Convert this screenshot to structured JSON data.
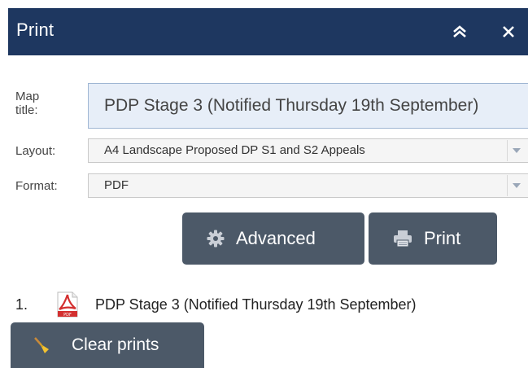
{
  "header": {
    "title": "Print",
    "collapse_icon": "double-chevron-up-icon",
    "close_icon": "close-icon"
  },
  "form": {
    "map_title_label": "Map\ntitle:",
    "map_title_value": "PDP Stage 3 (Notified Thursday 19th September)",
    "layout_label": "Layout:",
    "layout_value": "A4 Landscape Proposed DP S1 and S2 Appeals",
    "format_label": "Format:",
    "format_value": "PDF"
  },
  "buttons": {
    "advanced_label": "Advanced",
    "advanced_icon": "gear-icon",
    "print_label": "Print",
    "print_icon": "printer-icon",
    "clear_label": "Clear prints",
    "clear_icon": "broom-icon"
  },
  "prints": [
    {
      "index": "1.",
      "icon": "pdf-file-icon",
      "name": "PDP Stage 3 (Notified Thursday 19th September)"
    }
  ],
  "colors": {
    "header_bg": "#1e3760",
    "button_bg": "#4c5968",
    "title_field_bg": "#e7eef8",
    "pdf_red": "#d32f2f"
  }
}
